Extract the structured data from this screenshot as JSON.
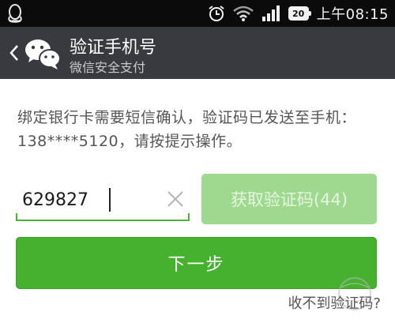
{
  "status_bar": {
    "time": "上午08:15",
    "battery_level": "20",
    "icons": [
      "qq-icon",
      "alarm-icon",
      "wifi-icon",
      "signal-icon",
      "battery-icon"
    ]
  },
  "header": {
    "title": "验证手机号",
    "subtitle": "微信安全支付",
    "back_icon": "back-chevron-icon",
    "logo_icon": "wechat-logo-icon",
    "background": "#393a3f"
  },
  "main": {
    "message": "绑定银行卡需要短信确认，验证码已发送至手机：138****5120，请按提示操作。",
    "code_input": {
      "value": "629827",
      "placeholder": ""
    },
    "get_code_button": "获取验证码(44)",
    "next_button": "下一步",
    "no_code_link": "收不到验证码?"
  },
  "colors": {
    "accent": "#45b12f",
    "disabled_button": "#9fd98f",
    "text": "#555555"
  },
  "watermark": {
    "text": "PConline"
  }
}
